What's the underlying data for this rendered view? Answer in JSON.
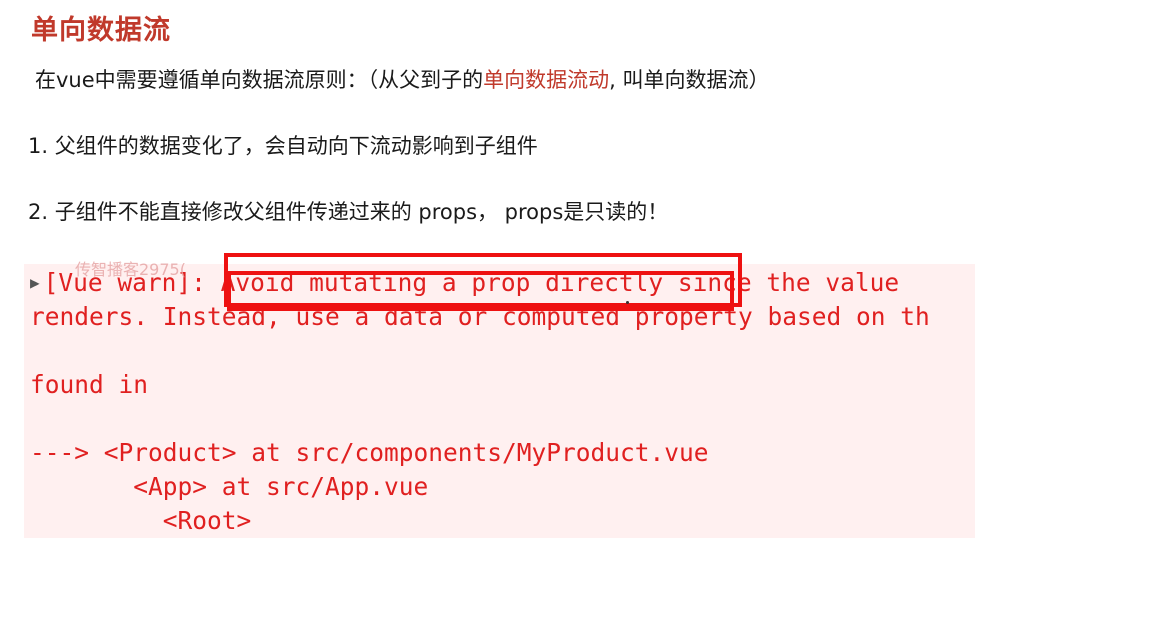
{
  "heading": "单向数据流",
  "intro": {
    "prefix": "在vue中需要遵循单向数据流原则：（从父到子的",
    "highlight": "单向数据流动",
    "suffix": ", 叫单向数据流）"
  },
  "rules": [
    "1. 父组件的数据变化了，会自动向下流动影响到子组件",
    "2. 子组件不能直接修改父组件传递过来的 props， props是只读的！"
  ],
  "watermark": "传智播客2975(",
  "console": {
    "expand_icon": "▶",
    "lines": [
      "[Vue warn]: Avoid mutating a prop directly since the value",
      "renders. Instead, use a data or computed property based on th",
      "",
      "found in",
      "",
      "---> <Product> at src/components/MyProduct.vue",
      "       <App> at src/App.vue",
      "         <Root>"
    ]
  },
  "colors": {
    "heading": "#c0392b",
    "highlight": "#c0392b",
    "console_text": "#e02020",
    "console_bg": "#fff0f0",
    "annotation_box": "#ee1111"
  }
}
